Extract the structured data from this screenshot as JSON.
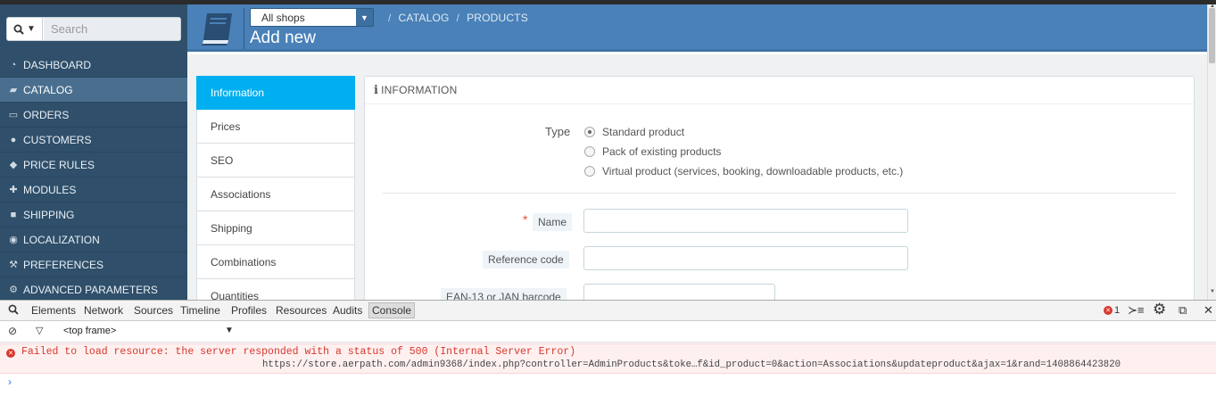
{
  "search": {
    "placeholder": "Search"
  },
  "sidebar": {
    "items": [
      {
        "label": "DASHBOARD",
        "icon": "dashboard-icon"
      },
      {
        "label": "CATALOG",
        "icon": "book-icon"
      },
      {
        "label": "ORDERS",
        "icon": "credit-card-icon"
      },
      {
        "label": "CUSTOMERS",
        "icon": "users-icon"
      },
      {
        "label": "PRICE RULES",
        "icon": "tag-icon"
      },
      {
        "label": "MODULES",
        "icon": "puzzle-icon"
      },
      {
        "label": "SHIPPING",
        "icon": "truck-icon"
      },
      {
        "label": "LOCALIZATION",
        "icon": "globe-icon"
      },
      {
        "label": "PREFERENCES",
        "icon": "wrench-icon"
      },
      {
        "label": "ADVANCED PARAMETERS",
        "icon": "cogs-icon"
      }
    ],
    "active": "CATALOG"
  },
  "header": {
    "shop_select": "All shops",
    "breadcrumb": [
      "CATALOG",
      "PRODUCTS"
    ],
    "title": "Add new"
  },
  "tabs": [
    "Information",
    "Prices",
    "SEO",
    "Associations",
    "Shipping",
    "Combinations",
    "Quantities"
  ],
  "panel": {
    "heading": "INFORMATION",
    "type_label": "Type",
    "type_options": [
      {
        "label": "Standard product",
        "checked": true
      },
      {
        "label": "Pack of existing products",
        "checked": false
      },
      {
        "label": "Virtual product (services, booking, downloadable products, etc.)",
        "checked": false
      }
    ],
    "fields": [
      {
        "label": "Name",
        "required": true,
        "value": ""
      },
      {
        "label": "Reference code",
        "required": false,
        "value": ""
      },
      {
        "label": "EAN-13 or JAN barcode",
        "required": false,
        "value": ""
      }
    ]
  },
  "devtools": {
    "tabs": [
      "Elements",
      "Network",
      "Sources",
      "Timeline",
      "Profiles",
      "Resources",
      "Audits",
      "Console"
    ],
    "selected_tab": "Console",
    "error_count": "1",
    "frame": "<top frame>",
    "error_message": "Failed to load resource: the server responded with a status of 500 (Internal Server Error)",
    "error_url": "https://store.aerpath.com/admin9368/index.php?controller=AdminProducts&toke…f&id_product=0&action=Associations&updateproduct&ajax=1&rand=1408864423820",
    "prompt": "›"
  },
  "colors": {
    "sidebar": "#2f4f6a",
    "header": "#4981b8",
    "active_tab": "#00aff0",
    "error": "#d6372b"
  }
}
